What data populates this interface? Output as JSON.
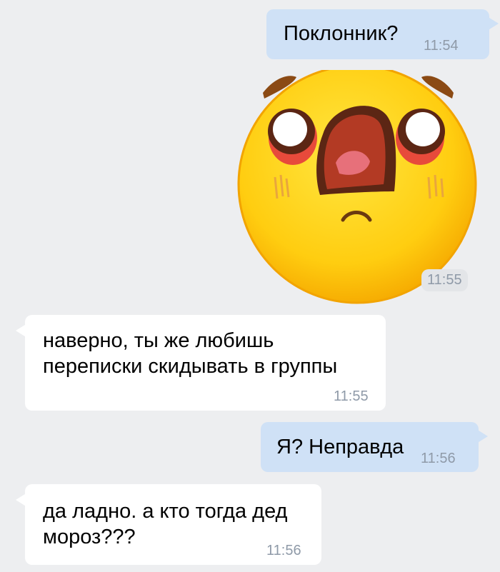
{
  "messages": [
    {
      "direction": "out",
      "text": "Поклонник?",
      "time": "11:54"
    },
    {
      "direction": "out",
      "type": "sticker",
      "sticker": "shocked-face-sticker",
      "time": "11:55"
    },
    {
      "direction": "in",
      "text": "наверно, ты же любишь\nпереписки скидывать в группы",
      "time": "11:55"
    },
    {
      "direction": "out",
      "text": "Я? Неправда",
      "time": "11:56"
    },
    {
      "direction": "in",
      "text": "да ладно. а кто тогда дед\nмороз???",
      "time": "11:56"
    }
  ],
  "colors": {
    "background": "#edeef0",
    "outgoing_bubble": "#cfe1f6",
    "incoming_bubble": "#ffffff",
    "timestamp": "#8f9aa8"
  }
}
